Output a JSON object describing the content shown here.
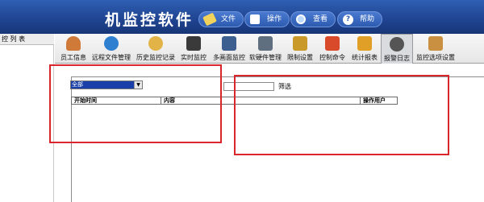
{
  "app": {
    "title": "机监控软件"
  },
  "header_menu": [
    {
      "label": "文件",
      "icon": "file-icon"
    },
    {
      "label": "操作",
      "icon": "operation-icon"
    },
    {
      "label": "查看",
      "icon": "view-icon"
    },
    {
      "label": "帮助",
      "icon": "help-icon"
    }
  ],
  "left_panel": {
    "title": "控 列 表"
  },
  "toolbar": [
    {
      "label": "员工信息",
      "icon": "employee-icon",
      "color": "#d07a3a"
    },
    {
      "label": "远程文件管理",
      "icon": "globe-icon",
      "color": "#2f7fd1"
    },
    {
      "label": "历史监控记录",
      "icon": "magnifier-icon",
      "color": "#e2b448"
    },
    {
      "label": "实时监控",
      "icon": "monitor-icon",
      "color": "#3a3a3a"
    },
    {
      "label": "多画面监控",
      "icon": "network-icon",
      "color": "#3c5f8f"
    },
    {
      "label": "软硬件管理",
      "icon": "clipboard-icon",
      "color": "#5f6f7f"
    },
    {
      "label": "限制设置",
      "icon": "lock-icon",
      "color": "#c99a2a"
    },
    {
      "label": "控制命令",
      "icon": "command-icon",
      "color": "#d94a2a"
    },
    {
      "label": "统计报表",
      "icon": "report-icon",
      "color": "#e0a028"
    },
    {
      "label": "报警日志",
      "icon": "alarm-icon",
      "color": "#555555",
      "active": true
    },
    {
      "label": "监控选项设置",
      "icon": "settings-icon",
      "color": "#c89040"
    }
  ],
  "content": {
    "select": {
      "value": "全部"
    },
    "filter": {
      "value": "",
      "label": "筛选"
    },
    "columns": [
      "开始时间",
      "内容",
      "操作用户"
    ]
  }
}
